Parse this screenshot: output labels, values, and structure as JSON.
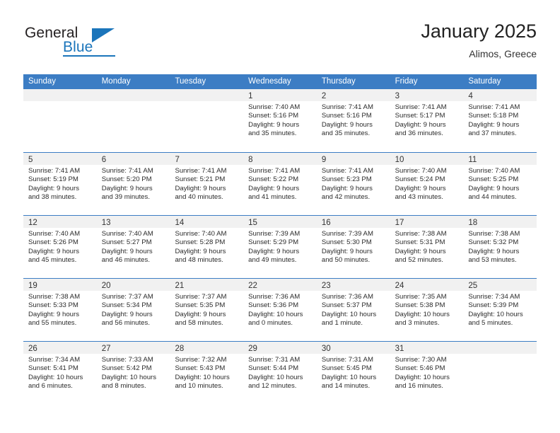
{
  "brand": {
    "name_part1": "General",
    "name_part2": "Blue",
    "accent_color": "#1b75bb"
  },
  "header": {
    "title": "January 2025",
    "subtitle": "Alimos, Greece"
  },
  "theme": {
    "header_row_bg": "#3c7dc4",
    "daynum_band_bg": "#f1f1f1",
    "row_divider": "#3c7dc4"
  },
  "calendar": {
    "weekday_headers": [
      "Sunday",
      "Monday",
      "Tuesday",
      "Wednesday",
      "Thursday",
      "Friday",
      "Saturday"
    ],
    "weeks": [
      [
        {
          "day": "",
          "lines": []
        },
        {
          "day": "",
          "lines": []
        },
        {
          "day": "",
          "lines": []
        },
        {
          "day": "1",
          "lines": [
            "Sunrise: 7:40 AM",
            "Sunset: 5:16 PM",
            "Daylight: 9 hours",
            "and 35 minutes."
          ]
        },
        {
          "day": "2",
          "lines": [
            "Sunrise: 7:41 AM",
            "Sunset: 5:16 PM",
            "Daylight: 9 hours",
            "and 35 minutes."
          ]
        },
        {
          "day": "3",
          "lines": [
            "Sunrise: 7:41 AM",
            "Sunset: 5:17 PM",
            "Daylight: 9 hours",
            "and 36 minutes."
          ]
        },
        {
          "day": "4",
          "lines": [
            "Sunrise: 7:41 AM",
            "Sunset: 5:18 PM",
            "Daylight: 9 hours",
            "and 37 minutes."
          ]
        }
      ],
      [
        {
          "day": "5",
          "lines": [
            "Sunrise: 7:41 AM",
            "Sunset: 5:19 PM",
            "Daylight: 9 hours",
            "and 38 minutes."
          ]
        },
        {
          "day": "6",
          "lines": [
            "Sunrise: 7:41 AM",
            "Sunset: 5:20 PM",
            "Daylight: 9 hours",
            "and 39 minutes."
          ]
        },
        {
          "day": "7",
          "lines": [
            "Sunrise: 7:41 AM",
            "Sunset: 5:21 PM",
            "Daylight: 9 hours",
            "and 40 minutes."
          ]
        },
        {
          "day": "8",
          "lines": [
            "Sunrise: 7:41 AM",
            "Sunset: 5:22 PM",
            "Daylight: 9 hours",
            "and 41 minutes."
          ]
        },
        {
          "day": "9",
          "lines": [
            "Sunrise: 7:41 AM",
            "Sunset: 5:23 PM",
            "Daylight: 9 hours",
            "and 42 minutes."
          ]
        },
        {
          "day": "10",
          "lines": [
            "Sunrise: 7:40 AM",
            "Sunset: 5:24 PM",
            "Daylight: 9 hours",
            "and 43 minutes."
          ]
        },
        {
          "day": "11",
          "lines": [
            "Sunrise: 7:40 AM",
            "Sunset: 5:25 PM",
            "Daylight: 9 hours",
            "and 44 minutes."
          ]
        }
      ],
      [
        {
          "day": "12",
          "lines": [
            "Sunrise: 7:40 AM",
            "Sunset: 5:26 PM",
            "Daylight: 9 hours",
            "and 45 minutes."
          ]
        },
        {
          "day": "13",
          "lines": [
            "Sunrise: 7:40 AM",
            "Sunset: 5:27 PM",
            "Daylight: 9 hours",
            "and 46 minutes."
          ]
        },
        {
          "day": "14",
          "lines": [
            "Sunrise: 7:40 AM",
            "Sunset: 5:28 PM",
            "Daylight: 9 hours",
            "and 48 minutes."
          ]
        },
        {
          "day": "15",
          "lines": [
            "Sunrise: 7:39 AM",
            "Sunset: 5:29 PM",
            "Daylight: 9 hours",
            "and 49 minutes."
          ]
        },
        {
          "day": "16",
          "lines": [
            "Sunrise: 7:39 AM",
            "Sunset: 5:30 PM",
            "Daylight: 9 hours",
            "and 50 minutes."
          ]
        },
        {
          "day": "17",
          "lines": [
            "Sunrise: 7:38 AM",
            "Sunset: 5:31 PM",
            "Daylight: 9 hours",
            "and 52 minutes."
          ]
        },
        {
          "day": "18",
          "lines": [
            "Sunrise: 7:38 AM",
            "Sunset: 5:32 PM",
            "Daylight: 9 hours",
            "and 53 minutes."
          ]
        }
      ],
      [
        {
          "day": "19",
          "lines": [
            "Sunrise: 7:38 AM",
            "Sunset: 5:33 PM",
            "Daylight: 9 hours",
            "and 55 minutes."
          ]
        },
        {
          "day": "20",
          "lines": [
            "Sunrise: 7:37 AM",
            "Sunset: 5:34 PM",
            "Daylight: 9 hours",
            "and 56 minutes."
          ]
        },
        {
          "day": "21",
          "lines": [
            "Sunrise: 7:37 AM",
            "Sunset: 5:35 PM",
            "Daylight: 9 hours",
            "and 58 minutes."
          ]
        },
        {
          "day": "22",
          "lines": [
            "Sunrise: 7:36 AM",
            "Sunset: 5:36 PM",
            "Daylight: 10 hours",
            "and 0 minutes."
          ]
        },
        {
          "day": "23",
          "lines": [
            "Sunrise: 7:36 AM",
            "Sunset: 5:37 PM",
            "Daylight: 10 hours",
            "and 1 minute."
          ]
        },
        {
          "day": "24",
          "lines": [
            "Sunrise: 7:35 AM",
            "Sunset: 5:38 PM",
            "Daylight: 10 hours",
            "and 3 minutes."
          ]
        },
        {
          "day": "25",
          "lines": [
            "Sunrise: 7:34 AM",
            "Sunset: 5:39 PM",
            "Daylight: 10 hours",
            "and 5 minutes."
          ]
        }
      ],
      [
        {
          "day": "26",
          "lines": [
            "Sunrise: 7:34 AM",
            "Sunset: 5:41 PM",
            "Daylight: 10 hours",
            "and 6 minutes."
          ]
        },
        {
          "day": "27",
          "lines": [
            "Sunrise: 7:33 AM",
            "Sunset: 5:42 PM",
            "Daylight: 10 hours",
            "and 8 minutes."
          ]
        },
        {
          "day": "28",
          "lines": [
            "Sunrise: 7:32 AM",
            "Sunset: 5:43 PM",
            "Daylight: 10 hours",
            "and 10 minutes."
          ]
        },
        {
          "day": "29",
          "lines": [
            "Sunrise: 7:31 AM",
            "Sunset: 5:44 PM",
            "Daylight: 10 hours",
            "and 12 minutes."
          ]
        },
        {
          "day": "30",
          "lines": [
            "Sunrise: 7:31 AM",
            "Sunset: 5:45 PM",
            "Daylight: 10 hours",
            "and 14 minutes."
          ]
        },
        {
          "day": "31",
          "lines": [
            "Sunrise: 7:30 AM",
            "Sunset: 5:46 PM",
            "Daylight: 10 hours",
            "and 16 minutes."
          ]
        },
        {
          "day": "",
          "lines": []
        }
      ]
    ]
  }
}
